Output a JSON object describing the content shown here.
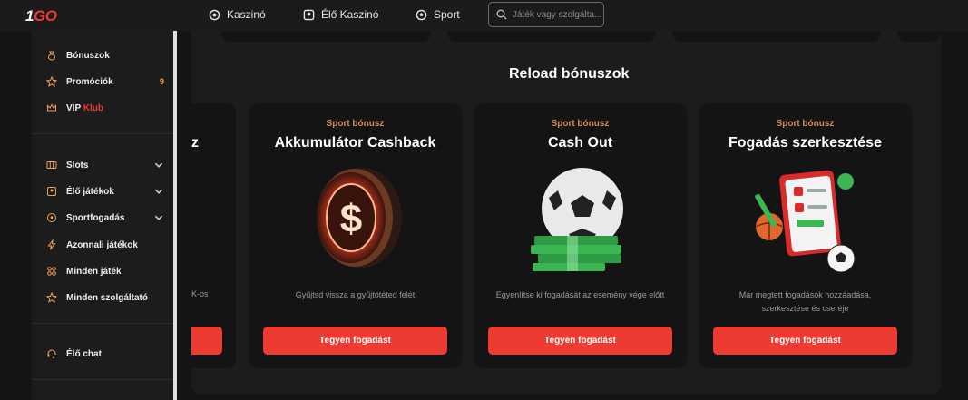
{
  "header": {
    "logo_one": "1",
    "logo_go": "GO",
    "nav": [
      {
        "label": "Kaszinó",
        "icon": "casino-chip-icon"
      },
      {
        "label": "Élő Kaszinó",
        "icon": "live-casino-icon"
      },
      {
        "label": "Sport",
        "icon": "soccer-ball-icon"
      }
    ],
    "search_placeholder": "Játék vagy szolgálta..."
  },
  "sidebar": {
    "items": [
      {
        "label": "Bónuszok",
        "icon": "bonus-bag-icon"
      },
      {
        "label": "Promóciók",
        "icon": "star-icon",
        "badge": "9"
      },
      {
        "label": "VIP ",
        "label_red": "Klub",
        "icon": "crown-icon"
      },
      {
        "label": "Slots",
        "icon": "slots-icon"
      },
      {
        "label": "Élő játékok",
        "icon": "live-games-icon"
      },
      {
        "label": "Sportfogadás",
        "icon": "sports-ball-icon"
      },
      {
        "label": "Azonnali játékok",
        "icon": "lightning-icon"
      },
      {
        "label": "Minden játék",
        "icon": "all-games-icon"
      },
      {
        "label": "Minden szolgáltató",
        "icon": "providers-star-icon"
      },
      {
        "label": "Élő chat",
        "icon": "headset-icon"
      }
    ]
  },
  "main": {
    "section_title": "Reload bónuszok",
    "partial_card": {
      "title_fragment": "z",
      "desc_fragment": "K-os"
    },
    "cards": [
      {
        "kicker": "Sport bónusz",
        "title": "Akkumulátor Cashback",
        "desc": "Gyűjtsd vissza a gyűjtötéted felét",
        "button": "Tegyen fogadást",
        "art": "dollar-coin-icon"
      },
      {
        "kicker": "Sport bónusz",
        "title": "Cash Out",
        "desc": "Egyenlítse ki fogadását az esemény vége előtt",
        "button": "Tegyen fogadást",
        "art": "soccer-ball-money-icon"
      },
      {
        "kicker": "Sport bónusz",
        "title": "Fogadás szerkesztése",
        "desc": "Már megtett fogadások hozzáadása, szerkesztése és cseréje",
        "button": "Tegyen fogadást",
        "art": "bet-slip-edit-icon"
      }
    ]
  },
  "colors": {
    "accent": "#ee3b32",
    "kicker": "#d58a56",
    "bg": "#141414",
    "panel": "#1c1c1c"
  }
}
